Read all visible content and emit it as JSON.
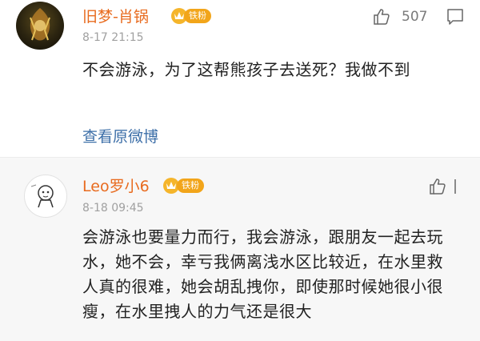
{
  "comments": [
    {
      "username": "旧梦-肖锅",
      "badge": "铁粉",
      "timestamp": "8-17 21:15",
      "content": "不会游泳，为了这帮熊孩子去送死？我做不到",
      "likes": "507",
      "view_original": "查看原微博"
    },
    {
      "username": "Leo罗小6",
      "badge": "铁粉",
      "timestamp": "8-18 09:45",
      "content": "会游泳也要量力而行，我会游泳，跟朋友一起去玩水，她不会，幸亏我俩离浅水区比较近，在水里救人真的很难，她会胡乱拽你，即使那时候她很小很瘦，在水里拽人的力气还是很大"
    }
  ],
  "colors": {
    "username": "#e86b1f",
    "badge": "#f2a51a",
    "link": "#3d6fa8",
    "timestamp": "#a0a0a0"
  }
}
